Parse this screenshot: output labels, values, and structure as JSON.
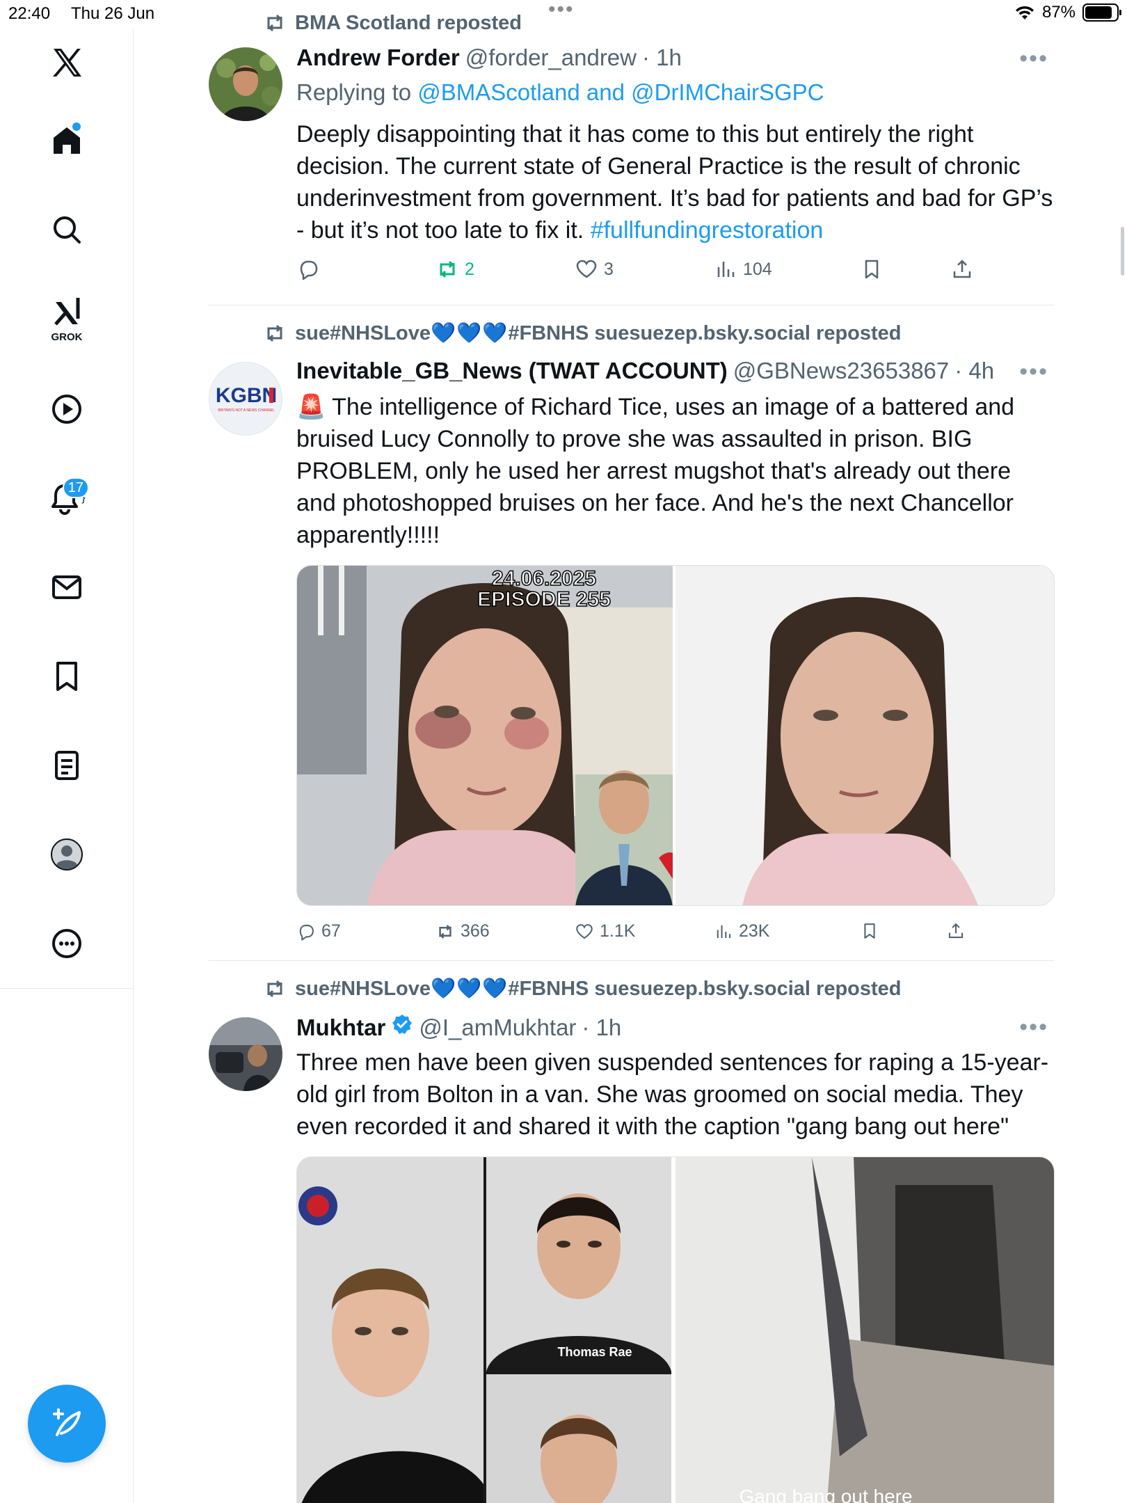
{
  "status_bar": {
    "time": "22:40",
    "date": "Thu 26 Jun",
    "battery": "87%",
    "battery_level": 0.87
  },
  "sidebar": {
    "notifications_badge": "17",
    "grok_label": "GROK",
    "items": [
      "x-logo",
      "home-icon",
      "search-icon",
      "grok-icon",
      "video-icon",
      "notifications-icon",
      "messages-icon",
      "bookmarks-icon",
      "lists-icon",
      "profile-icon",
      "more-icon"
    ]
  },
  "tweets": [
    {
      "repost_by": "BMA Scotland reposted",
      "name": "Andrew Forder",
      "handle": "@forder_andrew",
      "time": "· 1h",
      "replying_prefix": "Replying to",
      "replying_to": "@BMAScotland and @DrIMChairSGPC",
      "text": "Deeply disappointing that it has come to this but entirely the right decision. The current state of General Practice is the result of chronic underinvestment from government. It’s bad for patients and bad for GP’s - but it’s not too late to fix it.",
      "hashtag": "#fullfundingrestoration",
      "replies": "",
      "reposts": "2",
      "likes": "3",
      "views": "104"
    },
    {
      "repost_by_prefix": "sue#NHSLove",
      "repost_hearts": "💙💙💙",
      "repost_by_suffix": "#FBNHS suesuezep.bsky.social reposted",
      "name": "Inevitable_GB_News (TWAT ACCOUNT)",
      "handle": "@GBNews23653867",
      "time": "· 4h",
      "avatar_text": "KGBN",
      "avatar_subtext": "BRITAIN'S NOT A NEWS CHANNEL",
      "text": "🚨 The intelligence of Richard Tice, uses an image of a battered and bruised Lucy Connolly to prove she was assaulted in prison. BIG PROBLEM, only he used her arrest mugshot that's already out there and photoshopped bruises on her face. And he's the next Chancellor apparently!!!!!",
      "image_date": "24.06.2025",
      "image_episode": "EPISODE 255",
      "replies": "67",
      "reposts": "366",
      "likes": "1.1K",
      "views": "23K"
    },
    {
      "repost_by_prefix": "sue#NHSLove",
      "repost_hearts": "💙💙💙",
      "repost_by_suffix": "#FBNHS suesuezep.bsky.social reposted",
      "name": "Mukhtar",
      "handle": "@I_amMukhtar",
      "time": "· 1h",
      "text": "Three men have been given suspended sentences for raping a 15-year-old girl from Bolton in a  van. She was groomed on social media. They even recorded it and shared it with the caption \"gang bang out here\"",
      "image_caption_name": "Thomas Rae",
      "image_caption_video": "Gang bang out here"
    }
  ],
  "colors": {
    "accent": "#1d9bf0",
    "repost_green": "#00ba7c",
    "muted": "#536471",
    "text": "#0f1419"
  }
}
